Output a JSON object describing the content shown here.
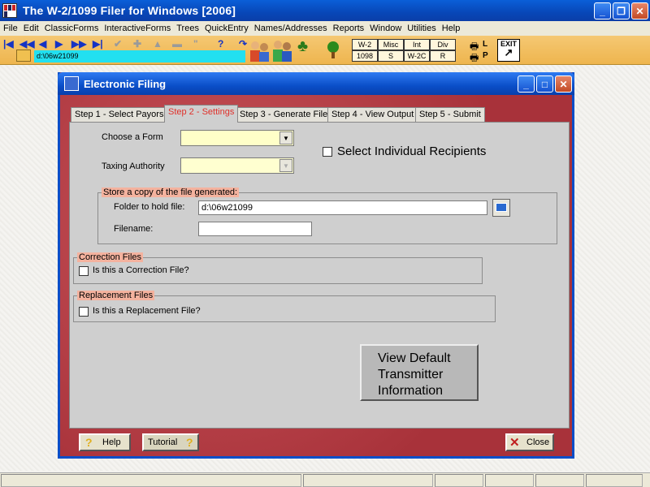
{
  "app": {
    "title": "The W-2/1099 Filer for Windows [2006]"
  },
  "menu": [
    "File",
    "Edit",
    "ClassicForms",
    "InteractiveForms",
    "Trees",
    "QuickEntry",
    "Names/Addresses",
    "Reports",
    "Window",
    "Utilities",
    "Help"
  ],
  "toolbar": {
    "path": "d:\\06w21099",
    "forms": [
      "W-2",
      "Misc",
      "Int",
      "Div",
      "1098",
      "S",
      "W-2C",
      "R"
    ],
    "print_l": "L",
    "print_p": "P",
    "exit": "EXIT"
  },
  "dialog": {
    "title": "Electronic Filing",
    "tabs": [
      "Step 1 - Select Payors",
      "Step 2 - Settings",
      "Step 3 - Generate File",
      "Step 4 - View Output",
      "Step 5 - Submit"
    ],
    "choose_form_label": "Choose a Form",
    "taxing_authority_label": "Taxing Authority",
    "select_individual_label": "Select Individual Recipients",
    "store_copy_legend": "Store a copy of the file generated:",
    "folder_label": "Folder to hold file:",
    "folder_value": "d:\\06w21099",
    "filename_label": "Filename:",
    "filename_value": "",
    "correction_legend": "Correction Files",
    "correction_label": "Is this a Correction File?",
    "replacement_legend": "Replacement Files",
    "replacement_label": "Is this a Replacement File?",
    "view_default_line1": "View Default",
    "view_default_line2": "Transmitter",
    "view_default_line3": "Information",
    "help_label": "Help",
    "tutorial_label": "Tutorial",
    "close_label": "Close"
  },
  "colors": {
    "accent": "#0a4ec8",
    "dialog_bg": "#b23a3a",
    "toolbar": "#eeb54e",
    "active_tab": "#e0302a"
  }
}
